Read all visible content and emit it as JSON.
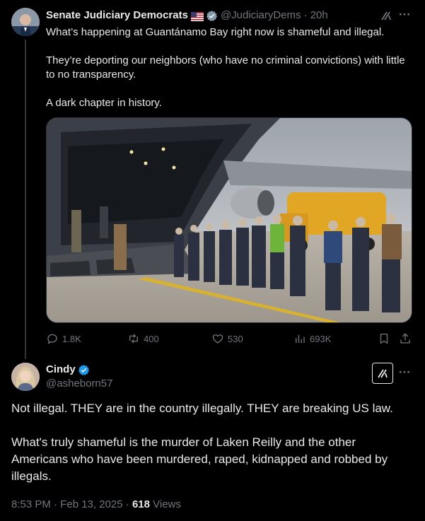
{
  "tweet1": {
    "author_name": "Senate Judiciary Democrats",
    "author_handle": "@JudiciaryDems",
    "time": "· 20h",
    "paragraphs": [
      "What’s happening at Guantánamo Bay right now is shameful and illegal.",
      "They’re deporting our neighbors (who have no criminal convictions) with little to no transparency.",
      "A dark chapter in history."
    ],
    "stats": {
      "replies": "1.8K",
      "reposts": "400",
      "likes": "530",
      "views": "693K"
    }
  },
  "tweet2": {
    "author_name": "Cindy",
    "author_handle": "@asheborn57",
    "paragraphs": [
      "Not illegal. THEY are in the country illegally. THEY are breaking US law.",
      "What's truly shameful is the murder of Laken Reilly and the other Americans who have been murdered, raped, kidnapped and robbed by illegals."
    ],
    "timestamp": "8:53 PM · Feb 13, 2025 · ",
    "views_count": "618",
    "views_label": " Views"
  },
  "colors": {
    "background": "#000000",
    "text": "#e7e9ea",
    "muted": "#71767b",
    "verified_blue": "#1d9bf0"
  }
}
